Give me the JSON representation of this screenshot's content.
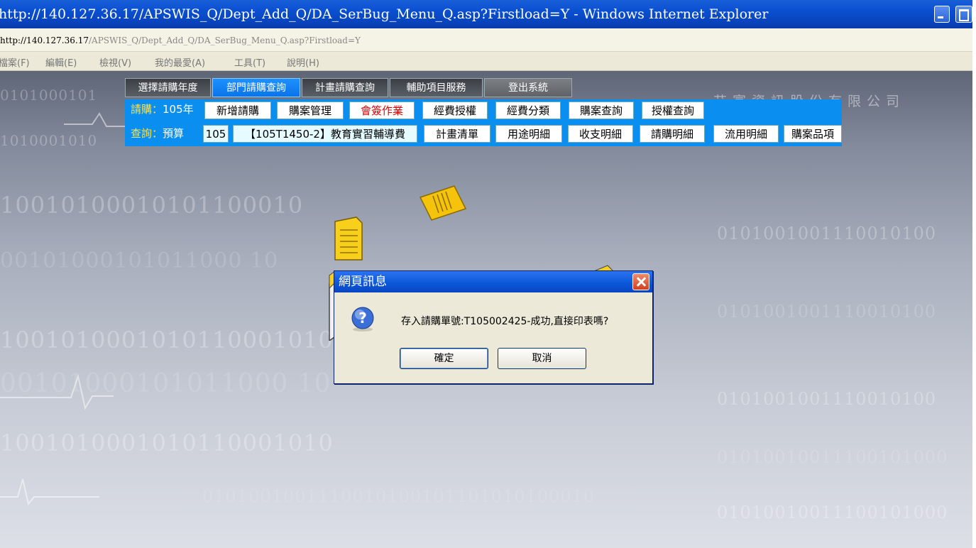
{
  "window": {
    "title": "http://140.127.36.17/APSWIS_Q/Dept_Add_Q/DA_SerBug_Menu_Q.asp?Firstload=Y - Windows Internet Explorer",
    "address_host": "http://140.127.36.17",
    "address_path": "/APSWIS_Q/Dept_Add_Q/DA_SerBug_Menu_Q.asp?Firstload=Y"
  },
  "menu": [
    "檔案(F)",
    "編輯(E)",
    "檢視(V)",
    "我的最愛(A)",
    "工具(T)",
    "說明(H)"
  ],
  "page": {
    "company": "艾富資訊股份有限公司",
    "binary_texts": [
      "0101000101",
      "1010001010",
      "10010100010101100010",
      "00101000101011000 10",
      "1001010001010110001010",
      "0101001001110010100",
      "0101001001110010100",
      "0101001001110010100",
      "01010010011100101000",
      "01010010011100101000",
      "0101001001110010100101101010100010"
    ]
  },
  "nav": {
    "tabs": [
      "選擇請購年度",
      "部門請購查詢",
      "計畫請購查詢",
      "輔助項目服務",
      "登出系統"
    ],
    "row2_label": "請購：",
    "row2_year": "105年",
    "row2_buttons": [
      "新增請購",
      "購案管理",
      "會簽作業",
      "經費授權",
      "經費分類",
      "購案查詢",
      "授權查詢"
    ],
    "row3_label": "查詢：",
    "row3_budget": "預算",
    "row3_year": "105",
    "row3_project": "【105T1450-2】教育實習輔導費",
    "row3_buttons": [
      "計畫清單",
      "用途明細",
      "收支明細",
      "請購明細",
      "流用明細",
      "購案品項"
    ]
  },
  "dialog": {
    "title": "網頁訊息",
    "message": "存入請購單號:T105002425-成功,直接印表嗎?",
    "ok_label": "確定",
    "cancel_label": "取消"
  },
  "colors": {
    "accent": "#0a8ff0",
    "title_bar": "#0a4fd0",
    "red_text": "#e00000"
  }
}
